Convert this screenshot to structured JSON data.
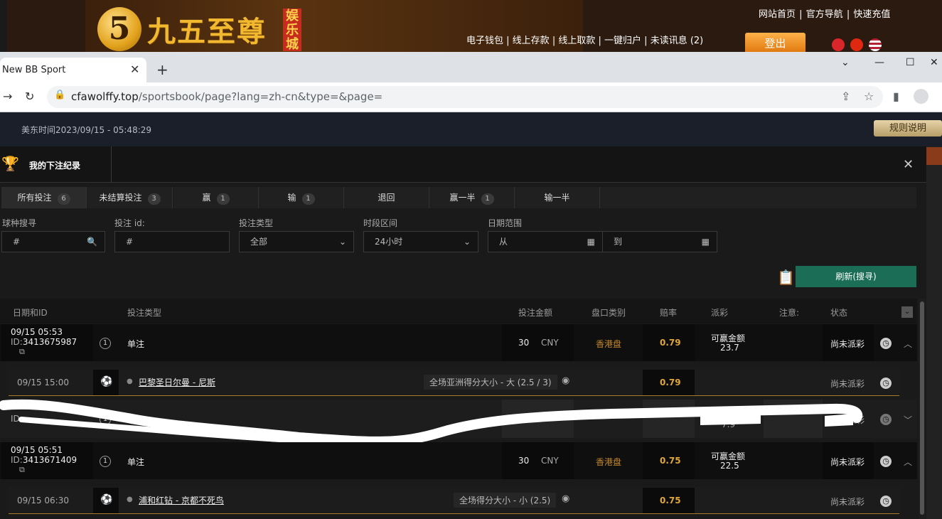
{
  "site": {
    "logo_mark": "5",
    "logo_text": "九五至尊",
    "logo_sub": "娱乐城",
    "top_links": [
      "网站首页",
      "官方导航",
      "快速充值"
    ],
    "nav_links": [
      "电子钱包",
      "线上存款",
      "线上取款",
      "一键归户",
      "未读讯息 (2)"
    ],
    "login_label": "登出",
    "flags": [
      "hk-flag",
      "cn-flag",
      "us-flag"
    ]
  },
  "browser": {
    "tab_title": "New BB Sport",
    "url_host": "cfawolffy.top",
    "url_path": "/sportsbook/page?lang=zh-cn&type=&page="
  },
  "page": {
    "us_time": "美东时间2023/09/15 - 05:48:29",
    "rules_label": "规则说明"
  },
  "modal": {
    "title": "我的下注纪录",
    "tabs": [
      {
        "label": "所有投注",
        "count": "6"
      },
      {
        "label": "未结算投注",
        "count": "3"
      },
      {
        "label": "赢",
        "count": "1"
      },
      {
        "label": "输",
        "count": "1"
      },
      {
        "label": "退回",
        "count": ""
      },
      {
        "label": "赢一半",
        "count": "1"
      },
      {
        "label": "输一半",
        "count": ""
      }
    ],
    "filters": {
      "sport_label": "球种搜寻",
      "sport_placeholder": "#",
      "betid_label": "投注 id:",
      "betid_placeholder": "#",
      "bettype_label": "投注类型",
      "bettype_value": "全部",
      "period_label": "时段区间",
      "period_value": "24小时",
      "daterange_label": "日期范围",
      "from_placeholder": "从",
      "to_placeholder": "到"
    },
    "refresh_label": "刷新(搜寻)",
    "columns": [
      "日期和ID",
      "投注类型",
      "投注金额",
      "盘口类别",
      "赔率",
      "派彩",
      "注意:",
      "状态"
    ],
    "bets": [
      {
        "datetime": "09/15 05:53",
        "id_prefix": "ID:",
        "id": "3413675987",
        "bet_type": "单注",
        "amount": "30",
        "currency": "CNY",
        "market_type": "香港盘",
        "odds": "0.79",
        "payout_label": "可赢金额",
        "payout": "23.7",
        "status": "尚未派彩",
        "detail": {
          "kickoff": "09/15 15:00",
          "match": "巴黎圣日尔曼 - 尼斯",
          "market": "全场亚洲得分大小 - 大 (2.5 / 3)",
          "odds": "0.79",
          "status": "尚未派彩"
        }
      },
      {
        "datetime": "",
        "id_prefix": "ID:",
        "id": "",
        "bet_type": "单注",
        "amount": "",
        "currency": "",
        "market_type": "",
        "odds": "",
        "payout_label": "",
        "payout": "7.9",
        "status": "尚未派彩"
      },
      {
        "datetime": "09/15 05:51",
        "id_prefix": "ID:",
        "id": "3413671409",
        "bet_type": "单注",
        "amount": "30",
        "currency": "CNY",
        "market_type": "香港盘",
        "odds": "0.75",
        "payout_label": "可赢金额",
        "payout": "22.5",
        "status": "尚未派彩",
        "detail": {
          "kickoff": "09/15 06:30",
          "match": "浦和红钻 - 京都不死鸟",
          "market": "全场得分大小 - 小 (2.5)",
          "odds": "0.75",
          "status": "尚未派彩"
        }
      }
    ]
  }
}
